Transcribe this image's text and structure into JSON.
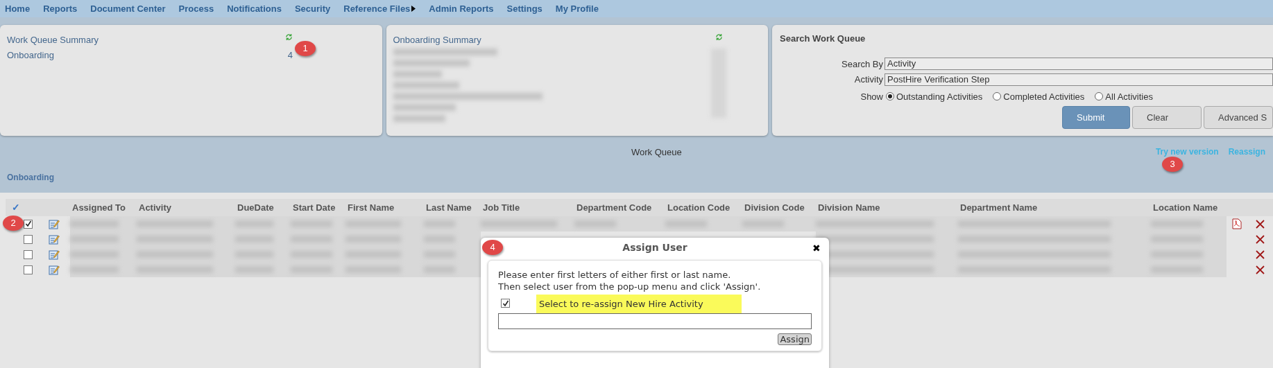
{
  "nav": [
    {
      "label": "Home"
    },
    {
      "label": "Reports"
    },
    {
      "label": "Document Center"
    },
    {
      "label": "Process"
    },
    {
      "label": "Notifications"
    },
    {
      "label": "Security"
    },
    {
      "label": "Reference Files",
      "submenu": true
    },
    {
      "label": "Admin Reports"
    },
    {
      "label": "Settings"
    },
    {
      "label": "My Profile"
    }
  ],
  "work_queue_summary": {
    "title": "Work Queue Summary",
    "items": [
      {
        "label": "Onboarding",
        "count": "4"
      }
    ]
  },
  "onboarding_summary": {
    "title": "Onboarding Summary"
  },
  "search": {
    "title": "Search Work Queue",
    "search_by_label": "Search By",
    "search_by_value": "Activity",
    "activity_label": "Activity",
    "activity_value": "PostHire Verification Step",
    "show_label": "Show",
    "options": [
      {
        "label": "Outstanding Activities",
        "selected": true
      },
      {
        "label": "Completed Activities",
        "selected": false
      },
      {
        "label": "All Activities",
        "selected": false
      }
    ],
    "buttons": [
      {
        "label": "Submit",
        "kind": "primary"
      },
      {
        "label": "Clear",
        "kind": "secondary"
      },
      {
        "label": "Advanced S",
        "kind": "secondary"
      }
    ]
  },
  "work_queue": {
    "title": "Work Queue",
    "links": [
      "Try new version",
      "Reassign"
    ],
    "section": "Onboarding"
  },
  "table": {
    "select_all": "✓",
    "columns": [
      "Assigned To",
      "Activity",
      "DueDate",
      "Start Date",
      "First Name",
      "Last Name",
      "Job Title",
      "Department Code",
      "Location Code",
      "Division Code",
      "Division Name",
      "Department Name",
      "Location Name"
    ],
    "rows": [
      {
        "checked": true,
        "attachment": true
      },
      {
        "checked": false,
        "attachment": false
      },
      {
        "checked": false,
        "attachment": false
      },
      {
        "checked": false,
        "attachment": false
      }
    ]
  },
  "dialog": {
    "title": "Assign User",
    "close": "✖",
    "instructions": [
      "Please enter first letters of either first or last name.",
      "Then select user from the pop-up menu and click 'Assign'."
    ],
    "reassign": {
      "label": "Select to re-assign New Hire Activity",
      "checked": true
    },
    "button": "Assign"
  },
  "callouts": [
    "1",
    "2",
    "3",
    "4"
  ]
}
